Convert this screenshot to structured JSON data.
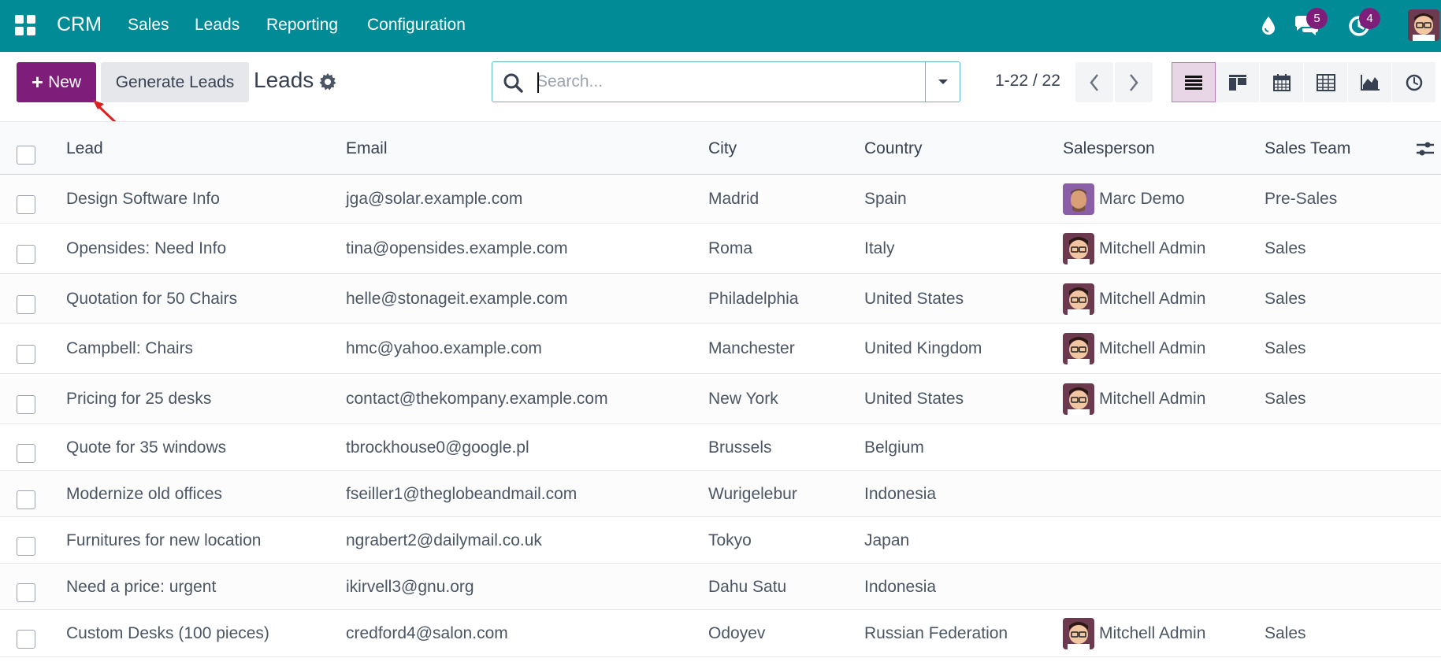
{
  "colors": {
    "brand": "#008b97",
    "accent": "#7f1e7a",
    "annotation": "#e02020"
  },
  "navbar": {
    "app_name": "CRM",
    "menu": [
      "Sales",
      "Leads",
      "Reporting",
      "Configuration"
    ],
    "messages_count": "5",
    "activities_count": "4",
    "icons": [
      "apps-grid-icon",
      "droplet-icon",
      "chat-icon",
      "clock-icon",
      "user-avatar"
    ]
  },
  "control": {
    "new_label": "New",
    "generate_label": "Generate Leads",
    "title": "Leads",
    "search_placeholder": "Search...",
    "pager": "1-22 / 22",
    "views": [
      "list-view-icon",
      "kanban-view-icon",
      "calendar-view-icon",
      "pivot-view-icon",
      "graph-view-icon",
      "activity-view-icon"
    ],
    "active_view": "list-view-icon"
  },
  "table": {
    "columns": [
      "Lead",
      "Email",
      "City",
      "Country",
      "Salesperson",
      "Sales Team"
    ],
    "rows": [
      {
        "lead": "Design Software Info",
        "email": "jga@solar.example.com",
        "city": "Madrid",
        "country": "Spain",
        "salesperson": "Marc Demo",
        "team": "Pre-Sales"
      },
      {
        "lead": "Opensides: Need Info",
        "email": "tina@opensides.example.com",
        "city": "Roma",
        "country": "Italy",
        "salesperson": "Mitchell Admin",
        "team": "Sales"
      },
      {
        "lead": "Quotation for 50 Chairs",
        "email": "helle@stonageit.example.com",
        "city": "Philadelphia",
        "country": "United States",
        "salesperson": "Mitchell Admin",
        "team": "Sales"
      },
      {
        "lead": "Campbell: Chairs",
        "email": "hmc@yahoo.example.com",
        "city": "Manchester",
        "country": "United Kingdom",
        "salesperson": "Mitchell Admin",
        "team": "Sales"
      },
      {
        "lead": "Pricing for 25 desks",
        "email": "contact@thekompany.example.com",
        "city": "New York",
        "country": "United States",
        "salesperson": "Mitchell Admin",
        "team": "Sales"
      },
      {
        "lead": "Quote for 35 windows",
        "email": "tbrockhouse0@google.pl",
        "city": "Brussels",
        "country": "Belgium",
        "salesperson": "",
        "team": ""
      },
      {
        "lead": "Modernize old offices",
        "email": "fseiller1@theglobeandmail.com",
        "city": "Wurigelebur",
        "country": "Indonesia",
        "salesperson": "",
        "team": ""
      },
      {
        "lead": "Furnitures for new location",
        "email": "ngrabert2@dailymail.co.uk",
        "city": "Tokyo",
        "country": "Japan",
        "salesperson": "",
        "team": ""
      },
      {
        "lead": "Need a price: urgent",
        "email": "ikirvell3@gnu.org",
        "city": "Dahu Satu",
        "country": "Indonesia",
        "salesperson": "",
        "team": ""
      },
      {
        "lead": "Custom Desks (100 pieces)",
        "email": "credford4@salon.com",
        "city": "Odoyev",
        "country": "Russian Federation",
        "salesperson": "Mitchell Admin",
        "team": "Sales"
      }
    ]
  }
}
